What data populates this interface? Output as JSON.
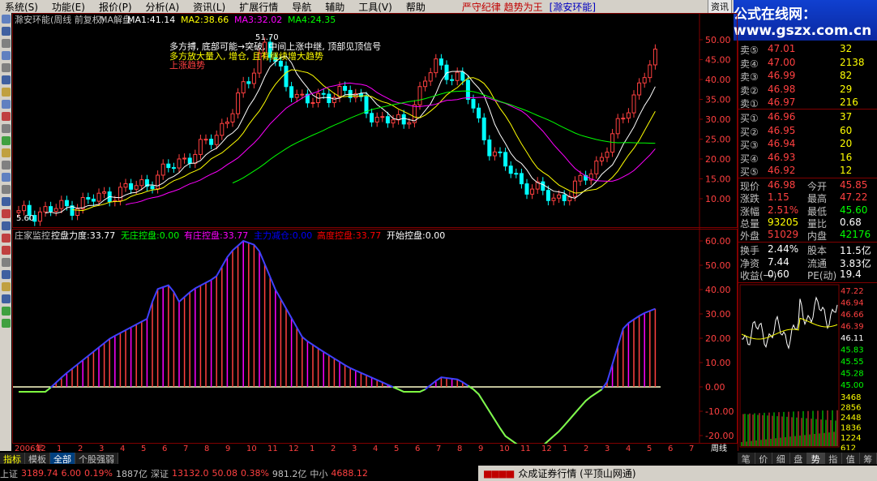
{
  "menu": {
    "items": [
      "系统(S)",
      "功能(E)",
      "报价(P)",
      "分析(A)",
      "资讯(L)",
      "扩展行情",
      "导航",
      "辅助",
      "工具(V)",
      "帮助"
    ],
    "slogan": "严守纪律 趋势为王",
    "slogan2": "[滁安环能]",
    "info_button": "资讯"
  },
  "brand": {
    "text": "公式在线网：www.gszx.com.cn"
  },
  "main_chart": {
    "title": "滁安环能(周线 前复权)",
    "indicator_name": "MA解盘",
    "ma": [
      {
        "label": "MA1:41.14",
        "color": "#ffffff"
      },
      {
        "label": "MA2:38.66",
        "color": "#ffff00"
      },
      {
        "label": "MA3:32.02",
        "color": "#ff00ff"
      },
      {
        "label": "MA4:24.35",
        "color": "#00ff00"
      }
    ],
    "annotation_top": "多方搏, 底部可能→突破, 中间上涨中继, 顶部见顶信号",
    "annotation_mid": "多方放大量入, 增仓, 且有继续增大趋势",
    "annotation_red": "上涨趋势",
    "peak_label": "51.70",
    "low_label": "5.60",
    "y_ticks": [
      "50.00",
      "45.00",
      "40.00",
      "35.00",
      "30.00",
      "25.00",
      "20.00",
      "15.00",
      "10.00"
    ],
    "y_values": [
      50,
      45,
      40,
      35,
      30,
      25,
      20,
      15,
      10
    ]
  },
  "sub_chart": {
    "title": "庄家监控",
    "labels": [
      {
        "text": "控盘力度:33.77",
        "color": "#ffffff"
      },
      {
        "text": "无庄控盘:0.00",
        "color": "#00ff00"
      },
      {
        "text": "有庄控盘:33.77",
        "color": "#ff00ff"
      },
      {
        "text": "主力减仓:0.00",
        "color": "#0000ff"
      },
      {
        "text": "高度控盘:33.77",
        "color": "#ff0000"
      },
      {
        "text": "开始控盘:0.00",
        "color": "#ffffff"
      }
    ],
    "y_ticks": [
      "60.00",
      "50.00",
      "40.00",
      "30.00",
      "20.00",
      "10.00",
      "0.00",
      "-10.00",
      "-20.00"
    ],
    "y_values": [
      60,
      50,
      40,
      30,
      20,
      10,
      0,
      -10,
      -20
    ]
  },
  "time_axis": {
    "labels": [
      "2006年",
      "12",
      "1",
      "2",
      "3",
      "4",
      "5",
      "6",
      "7",
      "8",
      "9",
      "10",
      "11",
      "12",
      "1",
      "2",
      "3",
      "4",
      "5",
      "6",
      "7",
      "8",
      "9",
      "10",
      "11",
      "12",
      "1",
      "2",
      "3",
      "4",
      "5",
      "6",
      "7"
    ],
    "period": "周线"
  },
  "order_book": {
    "sell": [
      {
        "label": "卖⑤",
        "price": "47.01",
        "vol": "32"
      },
      {
        "label": "卖④",
        "price": "47.00",
        "vol": "2138"
      },
      {
        "label": "卖③",
        "price": "46.99",
        "vol": "82"
      },
      {
        "label": "卖②",
        "price": "46.98",
        "vol": "29"
      },
      {
        "label": "卖①",
        "price": "46.97",
        "vol": "216"
      }
    ],
    "buy": [
      {
        "label": "买①",
        "price": "46.96",
        "vol": "37"
      },
      {
        "label": "买②",
        "price": "46.95",
        "vol": "60"
      },
      {
        "label": "买③",
        "price": "46.94",
        "vol": "20"
      },
      {
        "label": "买④",
        "price": "46.93",
        "vol": "16"
      },
      {
        "label": "买⑤",
        "price": "46.92",
        "vol": "12"
      }
    ]
  },
  "quote": [
    {
      "l1": "现价",
      "v1": "46.98",
      "c1": "#ff4040",
      "l2": "今开",
      "v2": "45.85",
      "c2": "#ff4040"
    },
    {
      "l1": "涨跌",
      "v1": "1.15",
      "c1": "#ff4040",
      "l2": "最高",
      "v2": "47.22",
      "c2": "#ff4040"
    },
    {
      "l1": "涨幅",
      "v1": "2.51%",
      "c1": "#ff4040",
      "l2": "最低",
      "v2": "45.60",
      "c2": "#00ff00"
    },
    {
      "l1": "总量",
      "v1": "93205",
      "c1": "#ffff00",
      "l2": "量比",
      "v2": "0.68",
      "c2": "#ffffff"
    },
    {
      "l1": "外盘",
      "v1": "51029",
      "c1": "#ff4040",
      "l2": "内盘",
      "v2": "42176",
      "c2": "#00ff00"
    }
  ],
  "stats": [
    {
      "l1": "换手",
      "v1": "2.44%",
      "l2": "股本",
      "v2": "11.5亿"
    },
    {
      "l1": "净资",
      "v1": "7.44",
      "l2": "流通",
      "v2": "3.83亿"
    },
    {
      "l1": "收益(一)",
      "v1": "0.60",
      "l2": "PE(动)",
      "v2": "19.4"
    }
  ],
  "mini_chart": {
    "y_ticks": [
      "47.22",
      "46.94",
      "46.66",
      "46.39",
      "46.11",
      "45.83",
      "45.55",
      "45.28",
      "45.00"
    ],
    "vol_ticks": [
      "3468",
      "2856",
      "2448",
      "1836",
      "1224",
      "612"
    ]
  },
  "bottom_tabs": [
    "指标",
    "模板",
    "全部",
    "个股强弱"
  ],
  "right_tabs": [
    "笔",
    "价",
    "细",
    "盘",
    "势",
    "指",
    "值",
    "筹"
  ],
  "status": {
    "sh_label": "上证",
    "sh_value": "3189.74",
    "sh_change": "6.00",
    "sh_pct": "0.19%",
    "sh_amount": "1887亿",
    "sz_label": "深证",
    "sz_value": "13132.0",
    "sz_change": "50.08",
    "sz_pct": "0.38%",
    "sz_amount": "981.2亿",
    "zx_label": "中小",
    "zx_value": "4688.12"
  },
  "ticker": "众成证券行情 (平顶山网通)",
  "colors": {
    "up": "#ff4040",
    "down": "#00ffff",
    "bg": "#000000",
    "axis": "#800000"
  }
}
